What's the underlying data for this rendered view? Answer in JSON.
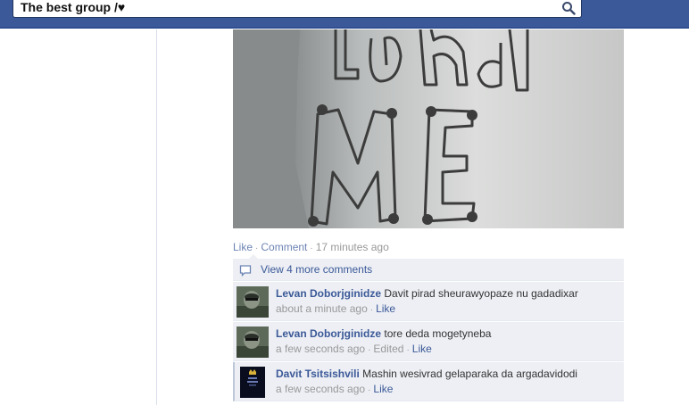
{
  "search": {
    "value": "The best group /♥"
  },
  "post": {
    "actions": {
      "like_label": "Like",
      "comment_label": "Comment",
      "time": "17 minutes ago"
    },
    "view_more_label": "View 4 more comments"
  },
  "comments": [
    {
      "author": "Levan Doborjginidze",
      "text": "Davit pirad sheurawyopaze nu gadadixar",
      "time": "about a minute ago",
      "edited": "",
      "like_label": "Like"
    },
    {
      "author": "Levan Doborjginidze",
      "text": "tore deda mogetyneba",
      "time": "a few seconds ago",
      "edited": "Edited",
      "like_label": "Like"
    },
    {
      "author": "Davit Tsitsishvili",
      "text": "Mashin wesivrad gelaparaka da argadavidodi",
      "time": "a few seconds ago",
      "edited": "",
      "like_label": "Like"
    }
  ],
  "colors": {
    "topbar": "#3b5998",
    "link": "#3b5998",
    "comment_bg": "#edeff4",
    "muted": "#999999"
  }
}
